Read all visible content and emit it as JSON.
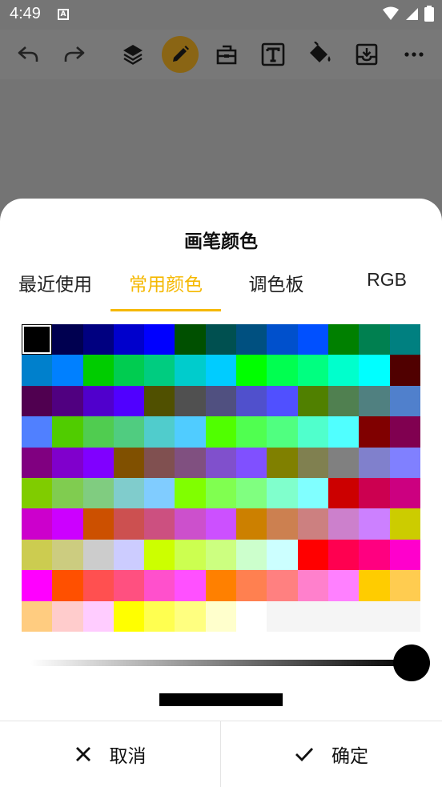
{
  "status_bar": {
    "time": "4:49",
    "notification": "A"
  },
  "toolbar": {
    "icons": [
      "undo-icon",
      "redo-icon",
      "layers-icon",
      "pencil-icon",
      "eraser-icon",
      "text-icon",
      "fill-bucket-icon",
      "save-icon",
      "more-icon"
    ],
    "active_icon": "pencil-icon",
    "text_icon_label": "T"
  },
  "sheet": {
    "title": "画笔颜色",
    "tabs": [
      "最近使用",
      "常用颜色",
      "调色板",
      "RGB"
    ],
    "active_tab": 1
  },
  "palette": {
    "selected": "#000000",
    "colors": [
      "#000000",
      "#000050",
      "#000080",
      "#0000CC",
      "#0000FF",
      "#005000",
      "#005050",
      "#005080",
      "#0050CC",
      "#0050FF",
      "#008000",
      "#008050",
      "#008080",
      "#0080CC",
      "#0080FF",
      "#00CC00",
      "#00CC50",
      "#00CC80",
      "#00CCCC",
      "#00CCFF",
      "#00FF00",
      "#00FF50",
      "#00FF80",
      "#00FFCC",
      "#00FFFF",
      "#500000",
      "#500050",
      "#500080",
      "#5000CC",
      "#5000FF",
      "#505000",
      "#505050",
      "#505080",
      "#5050CC",
      "#5050FF",
      "#508000",
      "#508050",
      "#508080",
      "#5080CC",
      "#5080FF",
      "#50CC00",
      "#50CC50",
      "#50CC80",
      "#50CCCC",
      "#50CCFF",
      "#50FF00",
      "#50FF50",
      "#50FF80",
      "#50FFCC",
      "#50FFFF",
      "#800000",
      "#800050",
      "#800080",
      "#8000CC",
      "#8000FF",
      "#805000",
      "#805050",
      "#805080",
      "#8050CC",
      "#8050FF",
      "#808000",
      "#808050",
      "#808080",
      "#8080CC",
      "#8080FF",
      "#80CC00",
      "#80CC50",
      "#80CC80",
      "#80CCCC",
      "#80CCFF",
      "#80FF00",
      "#80FF50",
      "#80FF80",
      "#80FFCC",
      "#80FFFF",
      "#CC0000",
      "#CC0050",
      "#CC0080",
      "#CC00CC",
      "#CC00FF",
      "#CC5000",
      "#CC5050",
      "#CC5080",
      "#CC50CC",
      "#CC50FF",
      "#CC8000",
      "#CC8050",
      "#CC8080",
      "#CC80CC",
      "#CC80FF",
      "#CCCC00",
      "#CCCC50",
      "#CCCC80",
      "#CCCCCC",
      "#CCCCFF",
      "#CCFF00",
      "#CCFF50",
      "#CCFF80",
      "#CCFFCC",
      "#CCFFFF",
      "#FF0000",
      "#FF0050",
      "#FF0080",
      "#FF00CC",
      "#FF00FF",
      "#FF5000",
      "#FF5050",
      "#FF5080",
      "#FF50CC",
      "#FF50FF",
      "#FF8000",
      "#FF8050",
      "#FF8080",
      "#FF80CC",
      "#FF80FF",
      "#FFCC00",
      "#FFCC50",
      "#FFCC80",
      "#FFCCCC",
      "#FFCCFF",
      "#FFFF00",
      "#FFFF50",
      "#FFFF80",
      "#FFFFCC",
      "#FFFFFF",
      "#F5F5F5",
      "#F5F5F5",
      "#F5F5F5",
      "#F5F5F5",
      "#F5F5F5"
    ]
  },
  "brightness_slider": {
    "value": 1.0
  },
  "preview_color": "#000000",
  "accent_color": "#F5B800",
  "footer": {
    "cancel_label": "取消",
    "confirm_label": "确定"
  }
}
